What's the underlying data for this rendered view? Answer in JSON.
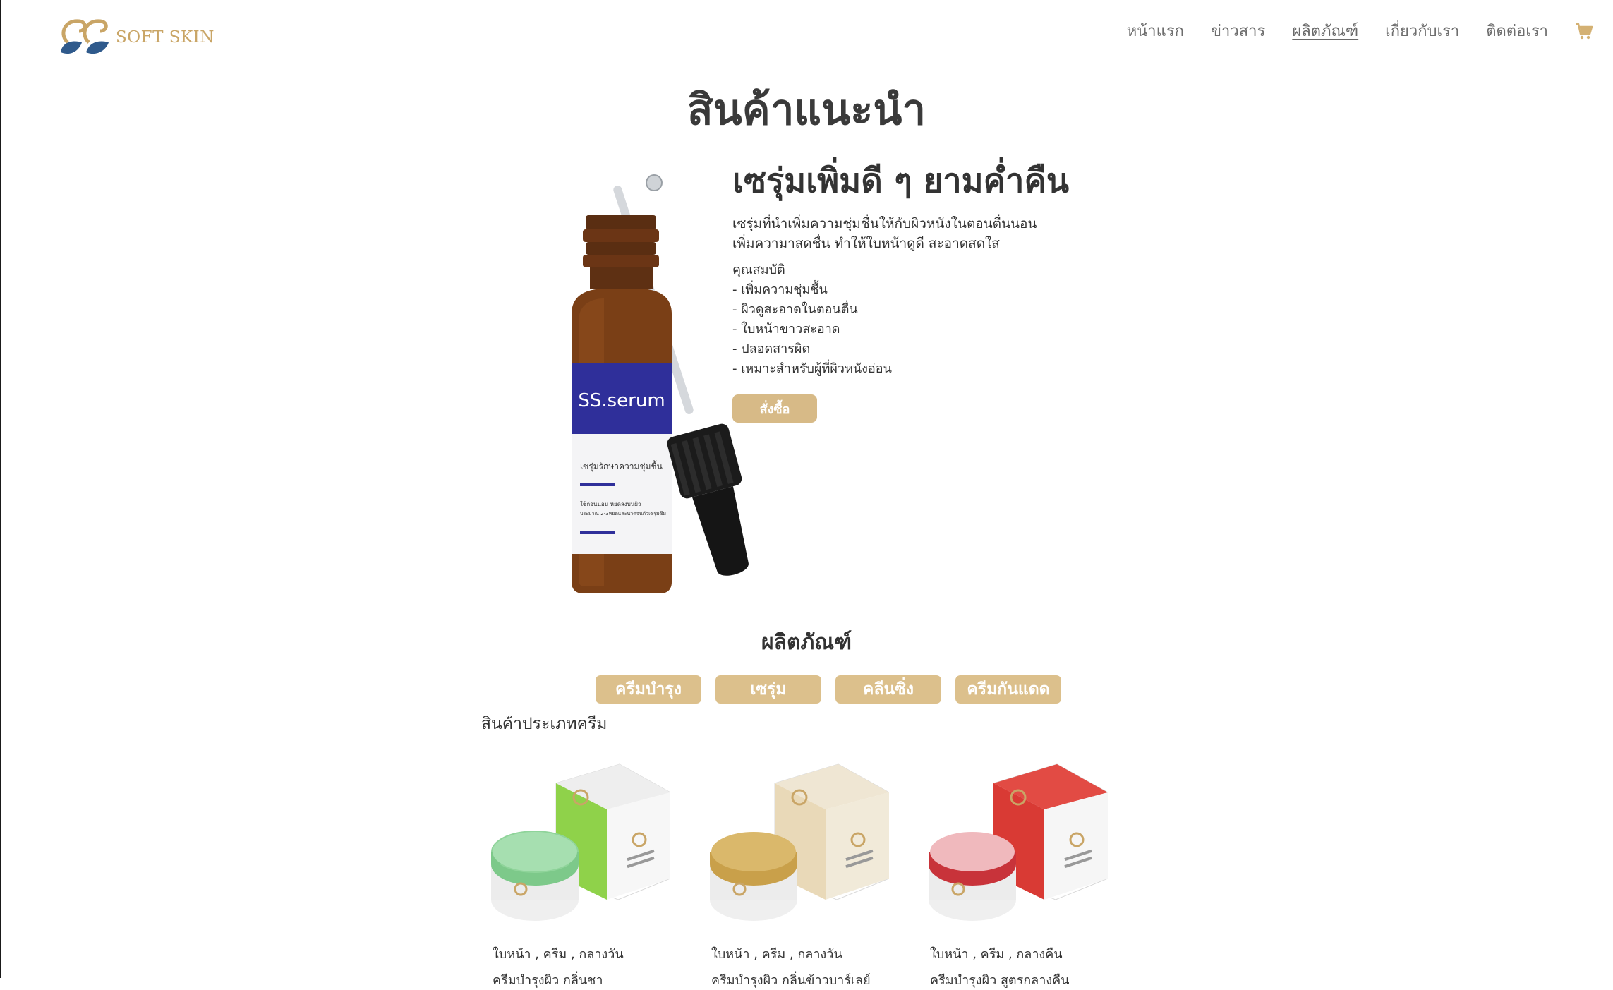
{
  "brand": {
    "logo_text": "SOFT SKIN",
    "accent": "#c9a566",
    "button_color": "#d7ba87"
  },
  "nav": {
    "items": [
      {
        "label": "หน้าแรก"
      },
      {
        "label": "ข่าวสาร"
      },
      {
        "label": "ผลิตภัณฑ์"
      },
      {
        "label": "เกี่ยวกับเรา"
      },
      {
        "label": "ติดต่อเรา"
      }
    ],
    "active": "ผลิตภัณฑ์",
    "cart_icon": "cart-icon"
  },
  "page_title": "สินค้าแนะนำ",
  "hero": {
    "title": "เซรุ่มเพิ่มดี ๆ ยามค่ำคืน",
    "desc_line1": "เซรุ่มที่นำเพิ่มความชุ่มชื่นให้กับผิวหนังในตอนตื่นนอน",
    "desc_line2": "เพิ่มความาสดชื่น ทำให้ใบหน้าดูดี สะอาดสดใส",
    "props_title": "คุณสมบัติ",
    "props": [
      "- เพิ่มความชุ่มชื้น",
      "- ผิวดูสะอาดในตอนตื่น",
      "- ใบหน้าขาวสะอาด",
      "- ปลอดสารผิด",
      "- เหมาะสำหรับผู้ที่ผิวหนังอ่อน"
    ],
    "order_label": "สั่งซื้อ",
    "image": {
      "label_brand": "SS.serum",
      "label_line1": "เซรุ่มรักษาความชุ่มชื้น",
      "label_line2": "ใช้ก่อนนอน หยดลงบนผิว",
      "label_line3": "ประมาณ 2-3หยดและนวดจนตัวเซรุ่มซึม"
    }
  },
  "products_section": {
    "title": "ผลิตภัณฑ์",
    "categories": [
      {
        "label": "ครีมบำรุง"
      },
      {
        "label": "เซรุ่ม"
      },
      {
        "label": "คลีนซิ่ง"
      },
      {
        "label": "ครีมกันแดด"
      }
    ],
    "category_label": "สินค้าประเภทครีม",
    "items": [
      {
        "tags": "ใบหน้า , ครีม , กลางวัน",
        "name": "ครีมบำรุงผิว กลิ่นชา",
        "color": "#8fd24a"
      },
      {
        "tags": "ใบหน้า , ครีม , กลางวัน",
        "name": "ครีมบำรุงผิว กลิ่นข้าวบาร์เลย์",
        "color": "#e9d9b8"
      },
      {
        "tags": "ใบหน้า , ครีม , กลางคืน",
        "name": "ครีมบำรุงผิว สูตรกลางคืน",
        "color": "#d93a34"
      }
    ]
  }
}
